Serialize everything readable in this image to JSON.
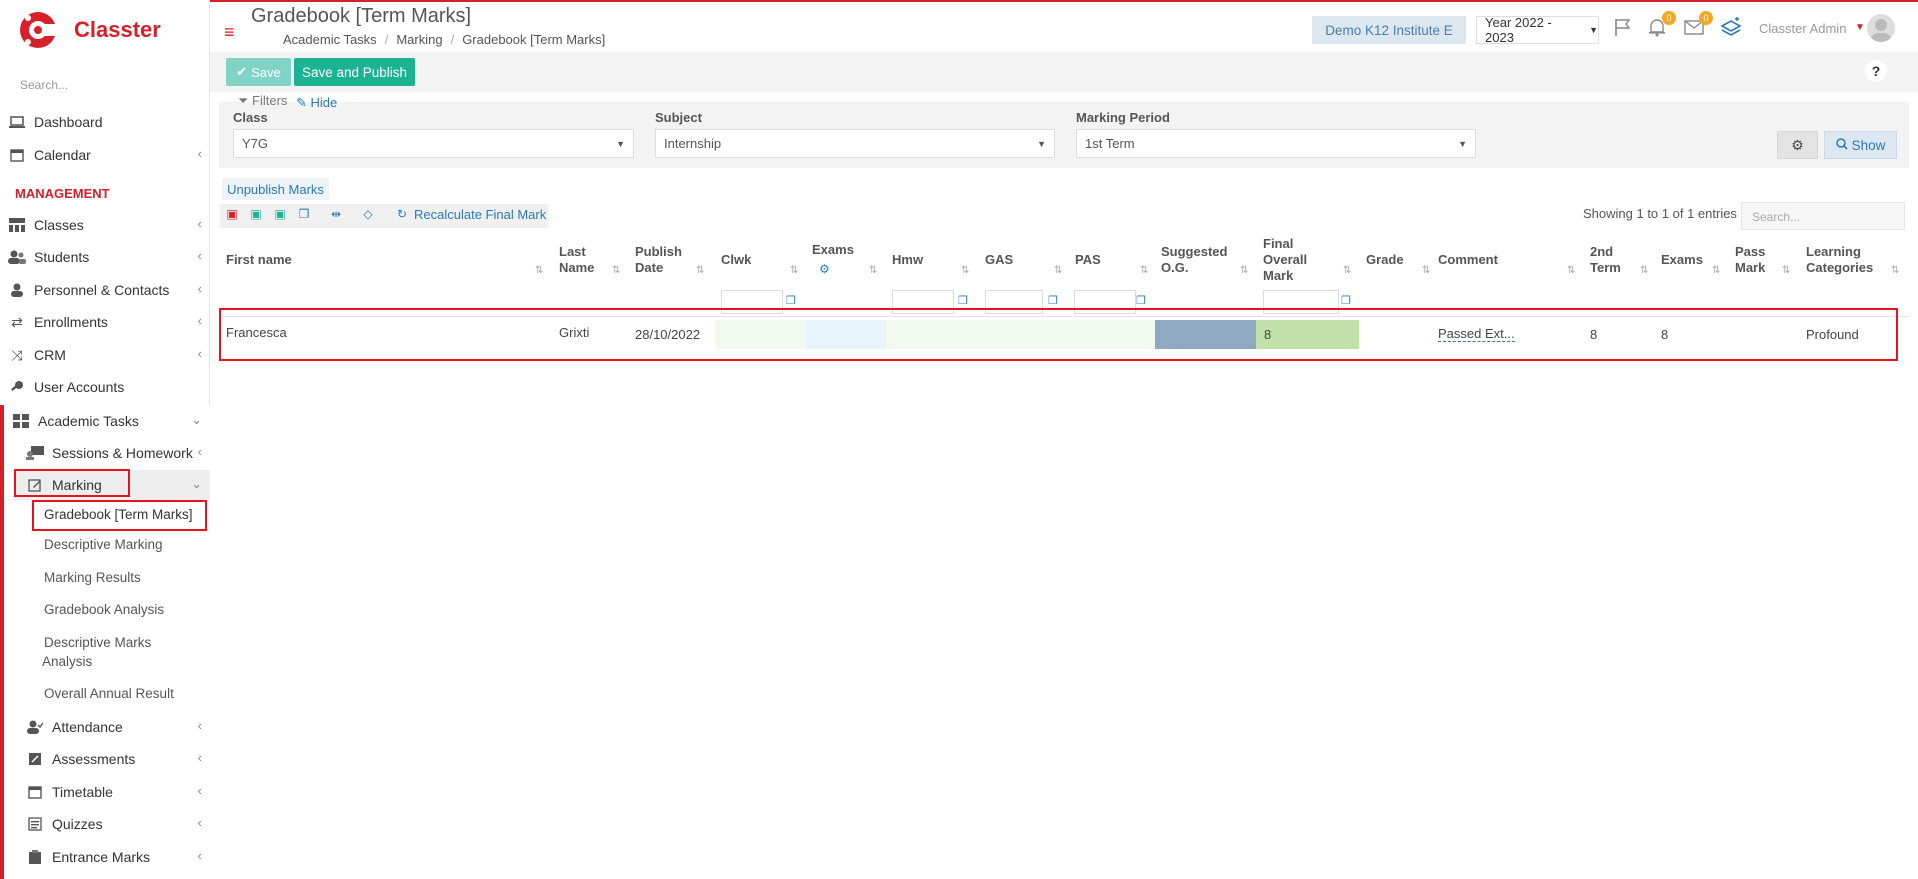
{
  "app": {
    "name": "Classter"
  },
  "sidebar": {
    "search_placeholder": "Search...",
    "items": [
      {
        "label": "Dashboard"
      },
      {
        "label": "Calendar"
      },
      {
        "label": "Classes"
      },
      {
        "label": "Students"
      },
      {
        "label": "Personnel & Contacts"
      },
      {
        "label": "Enrollments"
      },
      {
        "label": "CRM"
      },
      {
        "label": "User Accounts"
      },
      {
        "label": "Academic Tasks"
      }
    ],
    "section_management": "MANAGEMENT",
    "academic_sub": [
      {
        "label": "Sessions & Homework"
      },
      {
        "label": "Marking"
      },
      {
        "label": "Attendance"
      },
      {
        "label": "Assessments"
      },
      {
        "label": "Timetable"
      },
      {
        "label": "Quizzes"
      },
      {
        "label": "Entrance Marks"
      }
    ],
    "marking_sub": [
      {
        "label": "Gradebook [Term Marks]"
      },
      {
        "label": "Descriptive Marking"
      },
      {
        "label": "Marking Results"
      },
      {
        "label": "Gradebook Analysis"
      },
      {
        "label": "Descriptive Marks"
      },
      {
        "label": "Analysis"
      },
      {
        "label": "Overall Annual Result"
      }
    ]
  },
  "header": {
    "title": "Gradebook [Term Marks]",
    "breadcrumb": [
      "Academic Tasks",
      "Marking",
      "Gradebook [Term Marks]"
    ],
    "institute": "Demo K12 Institute E",
    "year": "Year 2022 - 2023",
    "notifications_count": "0",
    "messages_count": "0",
    "user": "Classter Admin"
  },
  "toolbar": {
    "save_label": "Save",
    "publish_label": "Save and Publish",
    "help_label": "?"
  },
  "filters": {
    "label": "Filters",
    "hide_label": "Hide",
    "class_label": "Class",
    "class_value": "Y7G",
    "subject_label": "Subject",
    "subject_value": "Internship",
    "period_label": "Marking Period",
    "period_value": "1st Term",
    "show_label": "Show"
  },
  "actions": {
    "unpublish_label": "Unpublish Marks",
    "recalc_label": "Recalculate Final Mark",
    "showing_text": "Showing 1 to 1 of 1 entries",
    "search_placeholder": "Search..."
  },
  "table": {
    "headers": {
      "first_name": "First name",
      "last_name_1": "Last",
      "last_name_2": "Name",
      "publish_1": "Publish",
      "publish_2": "Date",
      "clwk": "Clwk",
      "exams": "Exams",
      "hmw": "Hmw",
      "gas": "GAS",
      "pas": "PAS",
      "suggested_1": "Suggested",
      "suggested_2": "O.G.",
      "final_1": "Final",
      "final_2": "Overall",
      "final_3": "Mark",
      "grade": "Grade",
      "comment": "Comment",
      "term2_1": "2nd",
      "term2_2": "Term",
      "exams2": "Exams",
      "pass_1": "Pass",
      "pass_2": "Mark",
      "learning_1": "Learning",
      "learning_2": "Categories"
    },
    "rows": [
      {
        "first_name": "Francesca",
        "last_name": "Grixti",
        "publish_date": "28/10/2022",
        "final_mark": "8",
        "comment": "Passed Ext...",
        "term2": "8",
        "exams": "8",
        "learning": "Profound"
      }
    ]
  },
  "colors": {
    "brand": "#d52029",
    "primary_green": "#1cb394",
    "link_blue": "#2a7ab8",
    "suggested_bg": "#8faac0",
    "final_bg": "#c0e1a8"
  }
}
